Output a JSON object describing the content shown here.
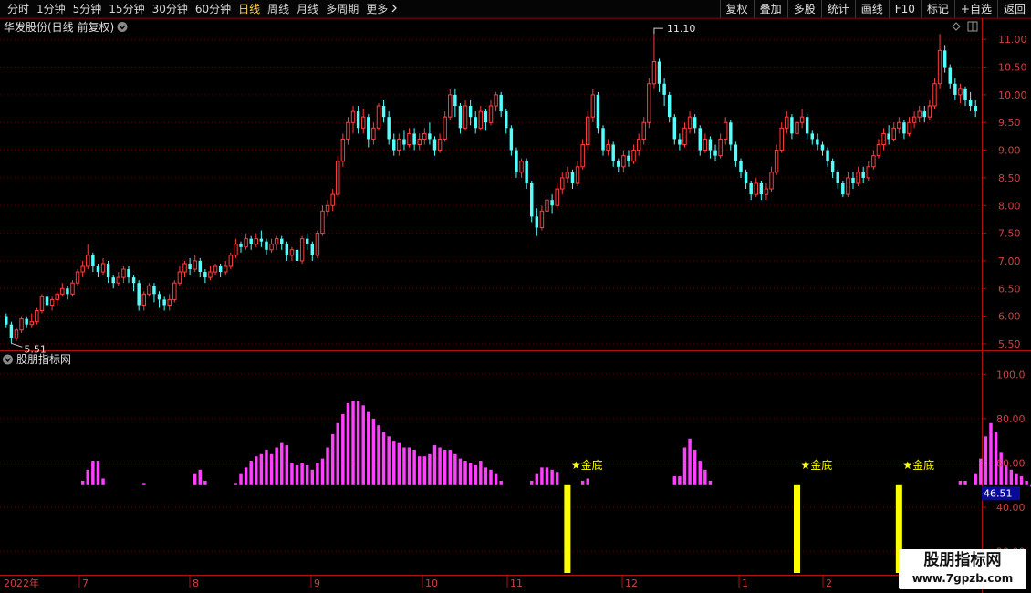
{
  "toolbar": {
    "periods": [
      "分时",
      "1分钟",
      "5分钟",
      "15分钟",
      "30分钟",
      "60分钟",
      "日线",
      "周线",
      "月线",
      "多周期",
      "更多"
    ],
    "active": "日线",
    "more_icon": "chevron-right-icon",
    "actions": [
      "复权",
      "叠加",
      "多股",
      "统计",
      "画线",
      "F10",
      "标记",
      "+自选",
      "返回"
    ]
  },
  "main_panel": {
    "title": "华发股份(日线 前复权)",
    "title_icon": "chevron-down-icon",
    "high_label": "11.10",
    "low_label": "5.51",
    "right_icons": [
      "diamond-icon",
      "panel-toggle-icon"
    ],
    "yticks": [
      "11.00",
      "10.50",
      "10.00",
      "9.50",
      "9.00",
      "8.50",
      "8.00",
      "7.50",
      "7.00",
      "6.50",
      "6.00",
      "5.50"
    ]
  },
  "indicator_panel": {
    "title": "股朋指标网",
    "title_icon": "chevron-down-icon",
    "yticks": [
      "100.0",
      "80.00",
      "60.00",
      "40.00",
      "20.00"
    ],
    "current_value": "46.51",
    "signal_label": "★金底"
  },
  "time_axis": {
    "labels": [
      "2022年",
      "7",
      "8",
      "9",
      "10",
      "11",
      "12",
      "1",
      "2"
    ]
  },
  "watermark": {
    "title": "股朋指标网",
    "url": "www.7gpzb.com"
  },
  "colors": {
    "up": "#ff3c3c",
    "down": "#54ffff",
    "indicator": "#ff40ff",
    "signal": "#ffff00",
    "grid": "#5a0000",
    "axis_text": "#d04040",
    "current_value_bg": "#0a0a9a"
  },
  "chart_data": {
    "type": "candlestick",
    "price_range": [
      5.4,
      11.35
    ],
    "price_high": 11.1,
    "price_low": 5.51,
    "candles": [
      [
        6.0,
        5.85,
        6.05,
        5.8
      ],
      [
        5.85,
        5.6,
        5.9,
        5.51
      ],
      [
        5.6,
        5.75,
        5.8,
        5.55
      ],
      [
        5.75,
        5.95,
        6.0,
        5.7
      ],
      [
        5.95,
        5.85,
        6.0,
        5.8
      ],
      [
        5.85,
        5.9,
        6.05,
        5.8
      ],
      [
        5.9,
        6.1,
        6.15,
        5.85
      ],
      [
        6.1,
        6.35,
        6.4,
        6.05
      ],
      [
        6.35,
        6.2,
        6.4,
        6.15
      ],
      [
        6.2,
        6.3,
        6.35,
        6.1
      ],
      [
        6.3,
        6.4,
        6.45,
        6.2
      ],
      [
        6.4,
        6.5,
        6.6,
        6.35
      ],
      [
        6.5,
        6.4,
        6.55,
        6.3
      ],
      [
        6.4,
        6.6,
        6.65,
        6.35
      ],
      [
        6.6,
        6.8,
        6.85,
        6.55
      ],
      [
        6.8,
        6.9,
        7.0,
        6.7
      ],
      [
        6.9,
        7.1,
        7.3,
        6.85
      ],
      [
        7.1,
        6.9,
        7.15,
        6.8
      ],
      [
        6.9,
        6.8,
        6.95,
        6.7
      ],
      [
        6.8,
        6.95,
        7.05,
        6.75
      ],
      [
        6.95,
        6.7,
        7.0,
        6.6
      ],
      [
        6.7,
        6.6,
        6.75,
        6.5
      ],
      [
        6.6,
        6.7,
        6.8,
        6.55
      ],
      [
        6.7,
        6.85,
        6.9,
        6.6
      ],
      [
        6.85,
        6.7,
        6.9,
        6.6
      ],
      [
        6.7,
        6.6,
        6.75,
        6.45
      ],
      [
        6.6,
        6.2,
        6.65,
        6.1
      ],
      [
        6.2,
        6.4,
        6.45,
        6.1
      ],
      [
        6.4,
        6.55,
        6.6,
        6.35
      ],
      [
        6.55,
        6.4,
        6.6,
        6.25
      ],
      [
        6.4,
        6.3,
        6.45,
        6.15
      ],
      [
        6.3,
        6.2,
        6.35,
        6.1
      ],
      [
        6.2,
        6.3,
        6.4,
        6.1
      ],
      [
        6.3,
        6.6,
        6.65,
        6.25
      ],
      [
        6.6,
        6.8,
        6.9,
        6.55
      ],
      [
        6.8,
        6.95,
        7.0,
        6.7
      ],
      [
        6.95,
        6.85,
        7.05,
        6.75
      ],
      [
        6.85,
        7.0,
        7.1,
        6.8
      ],
      [
        7.0,
        6.8,
        7.05,
        6.7
      ],
      [
        6.8,
        6.7,
        6.85,
        6.6
      ],
      [
        6.7,
        6.8,
        6.9,
        6.65
      ],
      [
        6.8,
        6.9,
        6.95,
        6.75
      ],
      [
        6.9,
        6.8,
        6.95,
        6.7
      ],
      [
        6.8,
        6.9,
        7.0,
        6.75
      ],
      [
        6.9,
        7.1,
        7.15,
        6.85
      ],
      [
        7.1,
        7.3,
        7.4,
        7.05
      ],
      [
        7.3,
        7.25,
        7.35,
        7.15
      ],
      [
        7.25,
        7.4,
        7.5,
        7.2
      ],
      [
        7.4,
        7.3,
        7.45,
        7.2
      ],
      [
        7.3,
        7.4,
        7.5,
        7.25
      ],
      [
        7.4,
        7.35,
        7.55,
        7.25
      ],
      [
        7.35,
        7.2,
        7.4,
        7.1
      ],
      [
        7.2,
        7.3,
        7.4,
        7.15
      ],
      [
        7.3,
        7.4,
        7.45,
        7.2
      ],
      [
        7.4,
        7.3,
        7.45,
        7.2
      ],
      [
        7.3,
        7.1,
        7.35,
        7.0
      ],
      [
        7.1,
        7.2,
        7.25,
        7.0
      ],
      [
        7.2,
        7.0,
        7.25,
        6.9
      ],
      [
        7.0,
        7.4,
        7.45,
        6.95
      ],
      [
        7.4,
        7.3,
        7.5,
        7.2
      ],
      [
        7.3,
        7.1,
        7.35,
        7.0
      ],
      [
        7.1,
        7.5,
        7.55,
        7.05
      ],
      [
        7.5,
        7.9,
        8.0,
        7.45
      ],
      [
        7.9,
        8.0,
        8.1,
        7.8
      ],
      [
        8.0,
        8.2,
        8.3,
        7.9
      ],
      [
        8.2,
        8.8,
        8.9,
        8.15
      ],
      [
        8.8,
        9.2,
        9.3,
        8.7
      ],
      [
        9.2,
        9.5,
        9.6,
        9.1
      ],
      [
        9.5,
        9.7,
        9.8,
        9.3
      ],
      [
        9.7,
        9.4,
        9.8,
        9.3
      ],
      [
        9.4,
        9.6,
        9.75,
        9.3
      ],
      [
        9.6,
        9.2,
        9.65,
        9.05
      ],
      [
        9.2,
        9.4,
        9.5,
        9.1
      ],
      [
        9.4,
        9.8,
        9.85,
        9.35
      ],
      [
        9.8,
        9.6,
        9.9,
        9.5
      ],
      [
        9.6,
        9.2,
        9.7,
        9.1
      ],
      [
        9.2,
        9.0,
        9.3,
        8.9
      ],
      [
        9.0,
        9.2,
        9.3,
        8.9
      ],
      [
        9.2,
        9.1,
        9.35,
        9.0
      ],
      [
        9.1,
        9.3,
        9.4,
        9.05
      ],
      [
        9.3,
        9.1,
        9.4,
        9.0
      ],
      [
        9.1,
        9.2,
        9.3,
        9.0
      ],
      [
        9.2,
        9.3,
        9.4,
        9.1
      ],
      [
        9.3,
        9.2,
        9.5,
        9.1
      ],
      [
        9.2,
        9.0,
        9.25,
        8.9
      ],
      [
        9.0,
        9.2,
        9.3,
        8.95
      ],
      [
        9.2,
        9.6,
        9.7,
        9.15
      ],
      [
        9.6,
        10.0,
        10.1,
        9.55
      ],
      [
        10.0,
        9.8,
        10.1,
        9.6
      ],
      [
        9.8,
        9.4,
        9.85,
        9.3
      ],
      [
        9.4,
        9.8,
        9.9,
        9.35
      ],
      [
        9.8,
        9.6,
        9.9,
        9.45
      ],
      [
        9.6,
        9.4,
        9.7,
        9.3
      ],
      [
        9.4,
        9.7,
        9.8,
        9.35
      ],
      [
        9.7,
        9.5,
        9.75,
        9.35
      ],
      [
        9.5,
        9.8,
        9.9,
        9.45
      ],
      [
        9.8,
        10.0,
        10.05,
        9.7
      ],
      [
        10.0,
        9.7,
        10.05,
        9.6
      ],
      [
        9.7,
        9.4,
        9.75,
        9.3
      ],
      [
        9.4,
        9.0,
        9.45,
        8.9
      ],
      [
        9.0,
        8.6,
        9.05,
        8.5
      ],
      [
        8.6,
        8.8,
        8.85,
        8.5
      ],
      [
        8.8,
        8.4,
        8.85,
        8.3
      ],
      [
        8.4,
        7.8,
        8.45,
        7.7
      ],
      [
        7.8,
        7.6,
        7.95,
        7.45
      ],
      [
        7.6,
        7.9,
        8.0,
        7.55
      ],
      [
        7.9,
        8.1,
        8.2,
        7.8
      ],
      [
        8.1,
        8.0,
        8.2,
        7.85
      ],
      [
        8.0,
        8.3,
        8.4,
        7.95
      ],
      [
        8.3,
        8.5,
        8.6,
        8.2
      ],
      [
        8.5,
        8.6,
        8.7,
        8.4
      ],
      [
        8.6,
        8.4,
        8.65,
        8.3
      ],
      [
        8.4,
        8.7,
        8.8,
        8.35
      ],
      [
        8.7,
        9.1,
        9.2,
        8.65
      ],
      [
        9.1,
        9.6,
        9.7,
        9.0
      ],
      [
        9.6,
        10.0,
        10.1,
        9.5
      ],
      [
        10.0,
        9.4,
        10.05,
        9.3
      ],
      [
        9.4,
        9.0,
        9.45,
        8.9
      ],
      [
        9.0,
        9.1,
        9.2,
        8.9
      ],
      [
        9.1,
        8.8,
        9.15,
        8.7
      ],
      [
        8.8,
        8.7,
        8.85,
        8.6
      ],
      [
        8.7,
        8.9,
        9.0,
        8.6
      ],
      [
        8.9,
        8.8,
        9.0,
        8.7
      ],
      [
        8.8,
        9.0,
        9.1,
        8.75
      ],
      [
        9.0,
        9.2,
        9.3,
        8.9
      ],
      [
        9.2,
        9.5,
        9.6,
        9.1
      ],
      [
        9.5,
        10.2,
        10.3,
        9.4
      ],
      [
        10.2,
        10.6,
        11.1,
        10.1
      ],
      [
        10.6,
        10.2,
        10.65,
        10.05
      ],
      [
        10.2,
        10.0,
        10.3,
        9.8
      ],
      [
        10.0,
        9.6,
        10.05,
        9.5
      ],
      [
        9.6,
        9.2,
        9.65,
        9.1
      ],
      [
        9.2,
        9.1,
        9.3,
        9.0
      ],
      [
        9.1,
        9.4,
        9.5,
        9.05
      ],
      [
        9.4,
        9.6,
        9.7,
        9.3
      ],
      [
        9.6,
        9.4,
        9.65,
        9.3
      ],
      [
        9.4,
        9.0,
        9.45,
        8.9
      ],
      [
        9.0,
        9.2,
        9.3,
        8.95
      ],
      [
        9.2,
        9.0,
        9.25,
        8.85
      ],
      [
        9.0,
        8.9,
        9.1,
        8.8
      ],
      [
        8.9,
        9.2,
        9.3,
        8.85
      ],
      [
        9.2,
        9.5,
        9.6,
        9.1
      ],
      [
        9.5,
        9.1,
        9.55,
        9.0
      ],
      [
        9.1,
        8.8,
        9.15,
        8.7
      ],
      [
        8.8,
        8.6,
        8.85,
        8.5
      ],
      [
        8.6,
        8.4,
        8.65,
        8.3
      ],
      [
        8.4,
        8.2,
        8.45,
        8.1
      ],
      [
        8.2,
        8.4,
        8.5,
        8.15
      ],
      [
        8.4,
        8.2,
        8.45,
        8.1
      ],
      [
        8.2,
        8.3,
        8.4,
        8.1
      ],
      [
        8.3,
        8.6,
        8.7,
        8.25
      ],
      [
        8.6,
        9.0,
        9.1,
        8.55
      ],
      [
        9.0,
        9.4,
        9.5,
        8.95
      ],
      [
        9.4,
        9.6,
        9.7,
        9.3
      ],
      [
        9.6,
        9.3,
        9.65,
        9.2
      ],
      [
        9.3,
        9.5,
        9.6,
        9.25
      ],
      [
        9.5,
        9.6,
        9.75,
        9.4
      ],
      [
        9.6,
        9.3,
        9.65,
        9.2
      ],
      [
        9.3,
        9.2,
        9.35,
        9.1
      ],
      [
        9.2,
        9.1,
        9.3,
        9.0
      ],
      [
        9.1,
        9.0,
        9.15,
        8.9
      ],
      [
        9.0,
        8.8,
        9.05,
        8.7
      ],
      [
        8.8,
        8.6,
        8.85,
        8.5
      ],
      [
        8.6,
        8.4,
        8.65,
        8.3
      ],
      [
        8.4,
        8.2,
        8.45,
        8.15
      ],
      [
        8.2,
        8.5,
        8.6,
        8.15
      ],
      [
        8.5,
        8.4,
        8.6,
        8.3
      ],
      [
        8.4,
        8.6,
        8.7,
        8.35
      ],
      [
        8.6,
        8.5,
        8.7,
        8.4
      ],
      [
        8.5,
        8.7,
        8.8,
        8.45
      ],
      [
        8.7,
        8.9,
        9.0,
        8.65
      ],
      [
        8.9,
        9.1,
        9.2,
        8.85
      ],
      [
        9.1,
        9.3,
        9.4,
        9.0
      ],
      [
        9.3,
        9.2,
        9.45,
        9.1
      ],
      [
        9.2,
        9.4,
        9.5,
        9.15
      ],
      [
        9.4,
        9.5,
        9.6,
        9.3
      ],
      [
        9.5,
        9.3,
        9.55,
        9.2
      ],
      [
        9.3,
        9.5,
        9.6,
        9.25
      ],
      [
        9.5,
        9.6,
        9.7,
        9.4
      ],
      [
        9.6,
        9.7,
        9.8,
        9.5
      ],
      [
        9.7,
        9.6,
        9.8,
        9.5
      ],
      [
        9.6,
        9.8,
        9.9,
        9.55
      ],
      [
        9.8,
        10.2,
        10.3,
        9.75
      ],
      [
        10.2,
        10.8,
        11.1,
        10.1
      ],
      [
        10.8,
        10.5,
        10.9,
        10.4
      ],
      [
        10.5,
        10.2,
        10.55,
        10.1
      ],
      [
        10.2,
        10.0,
        10.3,
        9.9
      ],
      [
        10.0,
        10.1,
        10.2,
        9.85
      ],
      [
        10.1,
        9.9,
        10.15,
        9.8
      ],
      [
        9.9,
        9.8,
        10.05,
        9.7
      ],
      [
        9.8,
        9.7,
        9.9,
        9.6
      ]
    ],
    "indicator_range": [
      10,
      110
    ],
    "indicator_baseline": 50,
    "indicator_current": 46.51,
    "indicator_values": [
      0,
      0,
      0,
      0,
      0,
      0,
      0,
      0,
      0,
      0,
      0,
      0,
      0,
      0,
      0,
      52,
      57,
      61,
      61,
      53,
      0,
      0,
      0,
      0,
      0,
      0,
      0,
      51,
      0,
      0,
      0,
      0,
      0,
      0,
      0,
      0,
      0,
      55,
      57,
      52,
      0,
      0,
      0,
      0,
      0,
      51,
      55,
      58,
      61,
      63,
      64,
      66,
      64,
      67,
      69,
      68,
      60,
      59,
      60,
      59,
      57,
      60,
      62,
      67,
      73,
      78,
      82,
      87,
      88,
      88,
      86,
      83,
      80,
      77,
      74,
      72,
      70,
      69,
      67,
      67,
      66,
      63,
      63,
      64,
      68,
      67,
      66,
      66,
      64,
      62,
      61,
      60,
      59,
      61,
      58,
      57,
      55,
      52,
      0,
      0,
      0,
      0,
      0,
      52,
      55,
      58,
      58,
      57,
      56,
      0,
      0,
      0,
      0,
      52,
      53,
      0,
      0,
      0,
      0,
      0,
      0,
      0,
      0,
      0,
      0,
      0,
      0,
      0,
      0,
      0,
      0,
      54,
      54,
      67,
      71,
      66,
      61,
      57,
      52,
      0,
      0,
      0,
      0,
      0,
      0,
      0,
      0,
      0,
      0,
      0,
      0,
      0,
      0,
      0,
      0,
      0,
      0,
      0,
      0,
      0,
      0,
      0,
      0,
      0,
      0,
      0,
      0,
      0,
      0,
      0,
      0,
      0,
      0,
      0,
      0,
      0,
      0,
      0,
      0,
      0,
      0,
      0,
      0,
      0,
      0,
      0,
      0,
      52,
      52,
      0,
      55,
      62,
      72,
      78,
      74,
      65,
      59,
      57,
      55,
      54,
      52,
      50,
      47
    ],
    "signal_bars": [
      110,
      155,
      175
    ],
    "signal_level": 50,
    "signal_bottom": 10
  }
}
